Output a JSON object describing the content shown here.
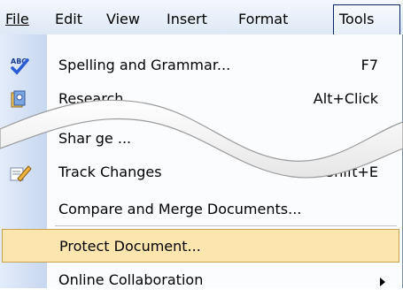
{
  "menubar": {
    "items": [
      {
        "label": "File",
        "active": false
      },
      {
        "label": "Edit",
        "active": false
      },
      {
        "label": "View",
        "active": false
      },
      {
        "label": "Insert",
        "active": false
      },
      {
        "label": "Format",
        "active": false
      },
      {
        "label": "Tools",
        "active": true
      }
    ]
  },
  "menu": {
    "items": [
      {
        "label": "Spelling and Grammar...",
        "shortcut": "F7",
        "icon": "spelling-abc-icon"
      },
      {
        "label": "Research...",
        "shortcut": "Alt+Click",
        "icon": "research-book-icon"
      },
      {
        "label": "Shar ge ...",
        "shortcut": "",
        "icon": "",
        "submenu": true
      },
      {
        "label": "Track Changes",
        "shortcut": "Ctrl+Shift+E",
        "icon": "track-changes-pencil-icon"
      },
      {
        "label": "Compare and Merge Documents...",
        "shortcut": "",
        "icon": ""
      },
      {
        "label": "Protect Document...",
        "shortcut": "",
        "icon": "",
        "highlighted": true
      },
      {
        "label": "Online Collaboration",
        "shortcut": "",
        "icon": "",
        "submenu": true
      }
    ]
  },
  "colors": {
    "highlight": "#fde5ae",
    "highlight_border": "#c8a24c",
    "active_border": "#0a246a",
    "icon_column": "#c7d7ef"
  }
}
